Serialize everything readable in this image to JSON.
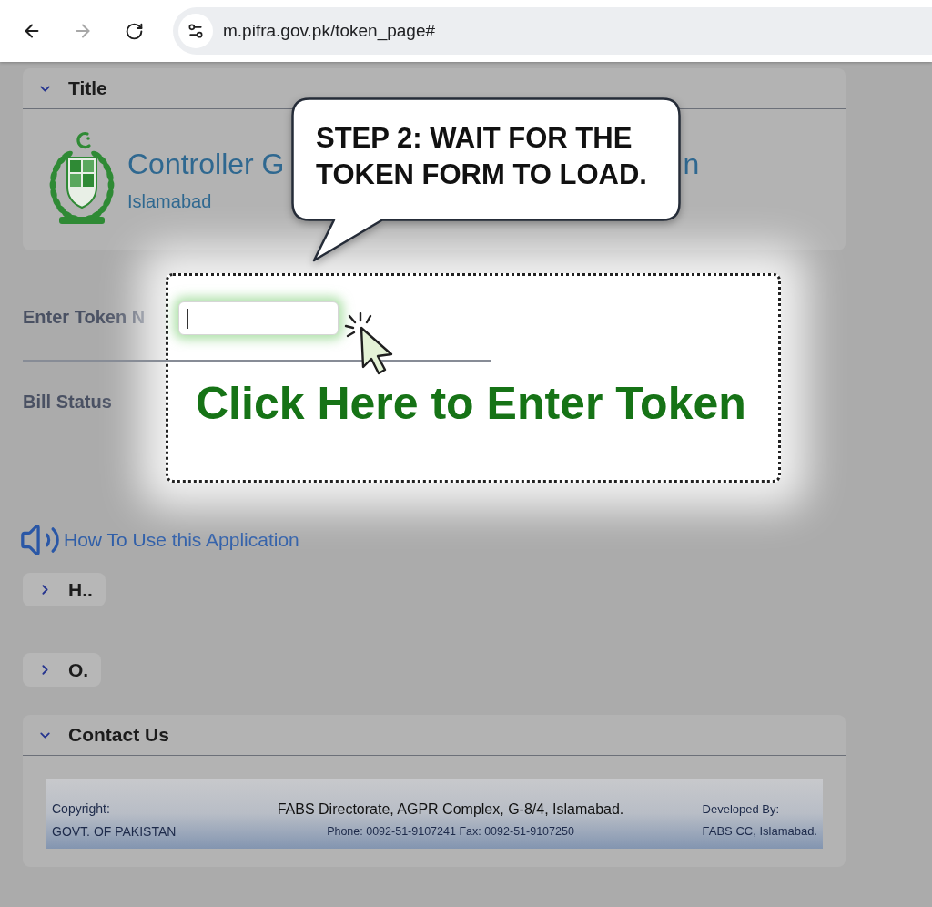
{
  "browser": {
    "forward_disabled": true,
    "url": "m.pifra.gov.pk/token_page#"
  },
  "title_panel": {
    "heading": "Title",
    "expanded": true,
    "org_name": "Controller G",
    "org_name_tail": "n",
    "org_city": "Islamabad"
  },
  "form": {
    "token_label": "Enter Token N",
    "bill_status_label": "Bill Status"
  },
  "help_link": {
    "label": "How To Use this Application"
  },
  "collapsed_panels": [
    {
      "heading": "H..",
      "expanded": false
    },
    {
      "heading": "O.",
      "expanded": false
    }
  ],
  "contact_panel": {
    "heading": "Contact Us",
    "expanded": true,
    "footer": {
      "copyright_label": "Copyright:",
      "copyright_holder": "GOVT. OF PAKISTAN",
      "address": "FABS Directorate, AGPR Complex, G-8/4, Islamabad.",
      "phone": "Phone: 0092-51-9107241 Fax: 0092-51-9107250",
      "developer_label": "Developed By:",
      "developer": "FABS CC, Islamabad."
    }
  },
  "callout": {
    "text": "STEP 2: WAIT FOR THE TOKEN FORM TO LOAD."
  },
  "highlight": {
    "token_field": {
      "focused": true
    },
    "caption": "Click Here to Enter Token"
  }
}
